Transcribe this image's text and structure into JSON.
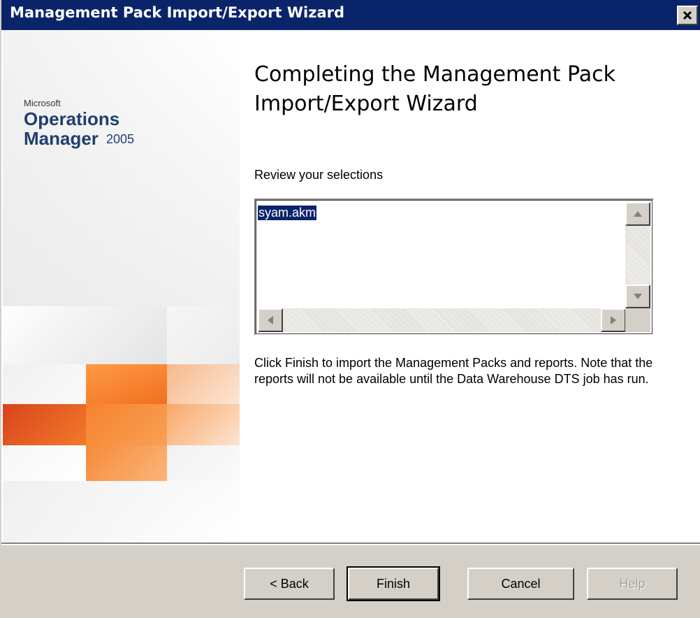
{
  "window": {
    "title": "Management Pack Import/Export Wizard",
    "close_glyph": "✕"
  },
  "branding": {
    "company": "Microsoft",
    "product_line1": "Operations",
    "product_line2": "Manager",
    "version": "2005"
  },
  "content": {
    "heading": "Completing the Management Pack Import/Export Wizard",
    "review_label": "Review your selections",
    "selections": [
      "syam.akm"
    ],
    "info": "Click Finish to import the Management Packs and reports. Note that the reports will not be available until the Data Warehouse DTS job has run."
  },
  "buttons": {
    "back": "< Back",
    "finish": "Finish",
    "cancel": "Cancel",
    "help": "Help"
  },
  "colors": {
    "title_bar": "#0a246a",
    "selection": "#0a246a",
    "face": "#d4d0c8",
    "brand_orange": "#f07a22"
  }
}
